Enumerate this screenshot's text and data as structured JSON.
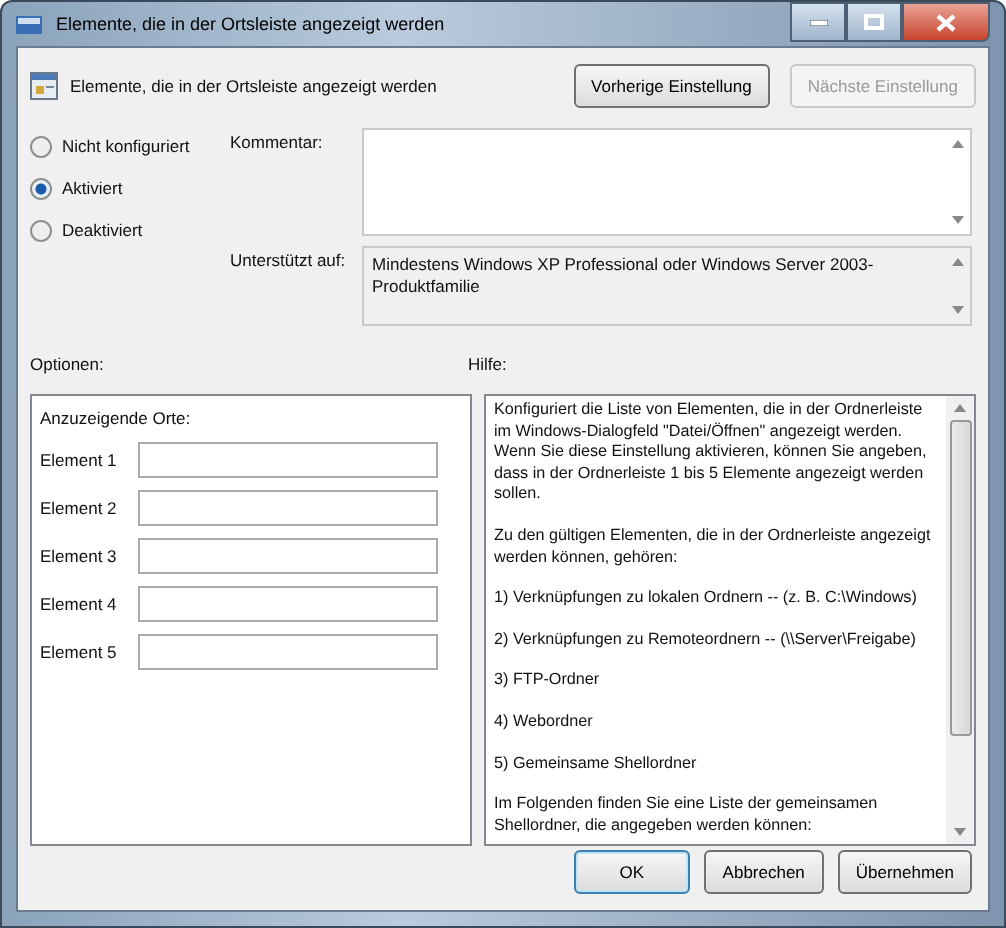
{
  "window": {
    "title": "Elemente, die in der Ortsleiste angezeigt werden"
  },
  "header": {
    "title": "Elemente, die in der Ortsleiste angezeigt werden",
    "buttons": [
      {
        "label": "Vorherige Einstellung",
        "disabled": false
      },
      {
        "label": "Nächste Einstellung",
        "disabled": true
      }
    ]
  },
  "state_options": [
    {
      "label": "Nicht konfiguriert",
      "selected": false
    },
    {
      "label": "Aktiviert",
      "selected": true
    },
    {
      "label": "Deaktiviert",
      "selected": false
    }
  ],
  "comment": {
    "label": "Kommentar:"
  },
  "supported": {
    "label": "Unterstützt auf:",
    "value": "Mindestens Windows XP Professional oder Windows Server 2003-Produktfamilie"
  },
  "options": {
    "label": "Optionen:",
    "heading": "Anzuzeigende Orte:",
    "fields": [
      {
        "label": "Element 1"
      },
      {
        "label": "Element 2"
      },
      {
        "label": "Element 3"
      },
      {
        "label": "Element 4"
      },
      {
        "label": "Element 5"
      }
    ]
  },
  "help": {
    "label": "Hilfe:",
    "paragraphs": [
      "Konfiguriert die Liste von Elementen, die in der Ordnerleiste im Windows-Dialogfeld \"Datei/Öffnen\" angezeigt werden. Wenn Sie diese Einstellung aktivieren, können Sie angeben, dass in der Ordnerleiste 1 bis 5 Elemente angezeigt werden sollen.",
      "Zu den gültigen Elementen, die in der Ordnerleiste angezeigt werden können, gehören:",
      "1) Verknüpfungen zu lokalen Ordnern -- (z. B. C:\\Windows)",
      "2) Verknüpfungen zu Remoteordnern -- (\\\\Server\\Freigabe)",
      "3) FTP-Ordner",
      "4) Webordner",
      "5) Gemeinsame Shellordner",
      "Im Folgenden finden Sie eine Liste der gemeinsamen Shellordner, die angegeben werden können:"
    ]
  },
  "buttons": [
    {
      "label": "OK",
      "default": true
    },
    {
      "label": "Abbrechen",
      "default": false
    },
    {
      "label": "Übernehmen",
      "default": false
    }
  ]
}
